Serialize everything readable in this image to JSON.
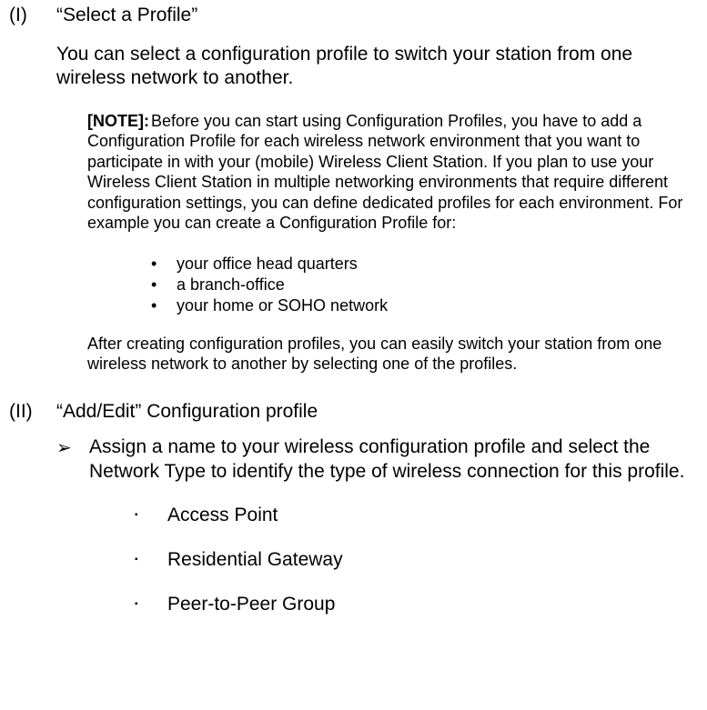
{
  "section1": {
    "label": "(I)",
    "title": "“Select a Profile”",
    "intro": "You can select a configuration profile to switch your station from one wireless network to another.",
    "note_label": "[NOTE]:",
    "note_body": "Before you can start using Configuration Profiles, you have to add a Configuration Profile for each wireless network environment that you want to participate in with your (mobile) Wireless Client Station. If you plan to use your Wireless Client Station in multiple networking environments that require different configuration settings, you can define dedicated profiles for each environment. For example you can create a Configuration Profile for:",
    "bullets": [
      "your office head quarters",
      "a branch-office",
      "your home or SOHO network"
    ],
    "after_note": "After creating configuration profiles, you can easily switch your station from one wireless network to another by selecting one of the profiles."
  },
  "section2": {
    "label": "(II)",
    "title": "“Add/Edit” Configuration profile",
    "arrow_glyph": "➢",
    "arrow_text": "Assign a name to your wireless configuration profile and select the Network Type to identify the type of wireless connection for this profile.",
    "square_glyph": "▪",
    "items": [
      "Access Point",
      "Residential Gateway",
      "Peer-to-Peer Group"
    ]
  }
}
